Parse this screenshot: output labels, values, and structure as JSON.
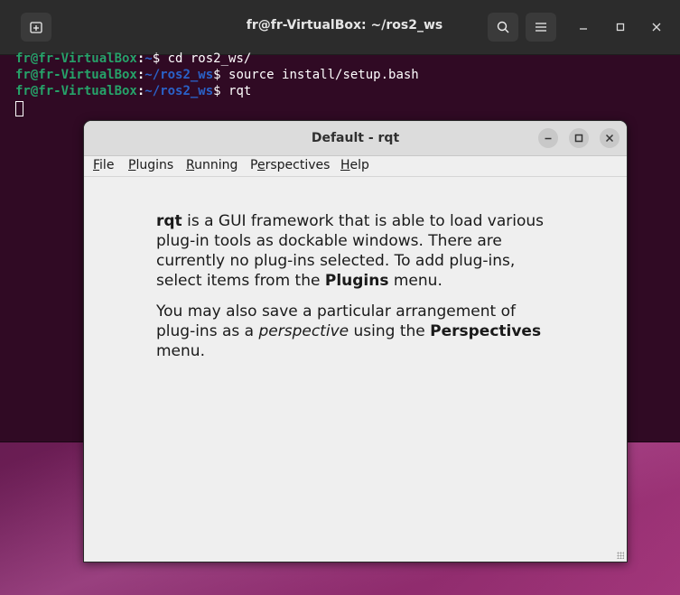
{
  "terminal": {
    "title": "fr@fr-VirtualBox: ~/ros2_ws",
    "lines": [
      {
        "user": "fr@fr-VirtualBox",
        "path": "~",
        "cmd": "$ cd ros2_ws/"
      },
      {
        "user": "fr@fr-VirtualBox",
        "path": "~/ros2_ws",
        "cmd": "$ source install/setup.bash"
      },
      {
        "user": "fr@fr-VirtualBox",
        "path": "~/ros2_ws",
        "cmd": "$ rqt"
      }
    ],
    "icons": {
      "new_tab": "new-tab-icon",
      "search": "search-icon",
      "menu": "hamburger-menu-icon",
      "minimize": "minimize-icon",
      "maximize": "maximize-icon",
      "close": "close-icon"
    }
  },
  "rqt": {
    "title": "Default - rqt",
    "menu": {
      "file": {
        "first": "F",
        "rest": "ile"
      },
      "plugins": {
        "first": "P",
        "rest": "lugins"
      },
      "running": {
        "first": "R",
        "rest": "unning"
      },
      "perspectives": {
        "pre": "P",
        "ul": "e",
        "rest": "rspectives"
      },
      "help": {
        "first": "H",
        "rest": "elp"
      }
    },
    "para1": {
      "b1": "rqt",
      "t1": " is a GUI framework that is able to load various plug-in tools as dockable windows. There are currently no plug-ins selected. To add plug-ins, select items from the ",
      "b2": "Plugins",
      "t2": " menu."
    },
    "para2": {
      "t1": "You may also save a particular arrangement of plug-ins as a ",
      "i1": "perspective",
      "t2": " using the ",
      "b1": "Perspectives",
      "t3": " menu."
    }
  },
  "colors": {
    "terminal_bg": "#300a24",
    "prompt_user": "#26a269",
    "prompt_path": "#2a62c9"
  }
}
